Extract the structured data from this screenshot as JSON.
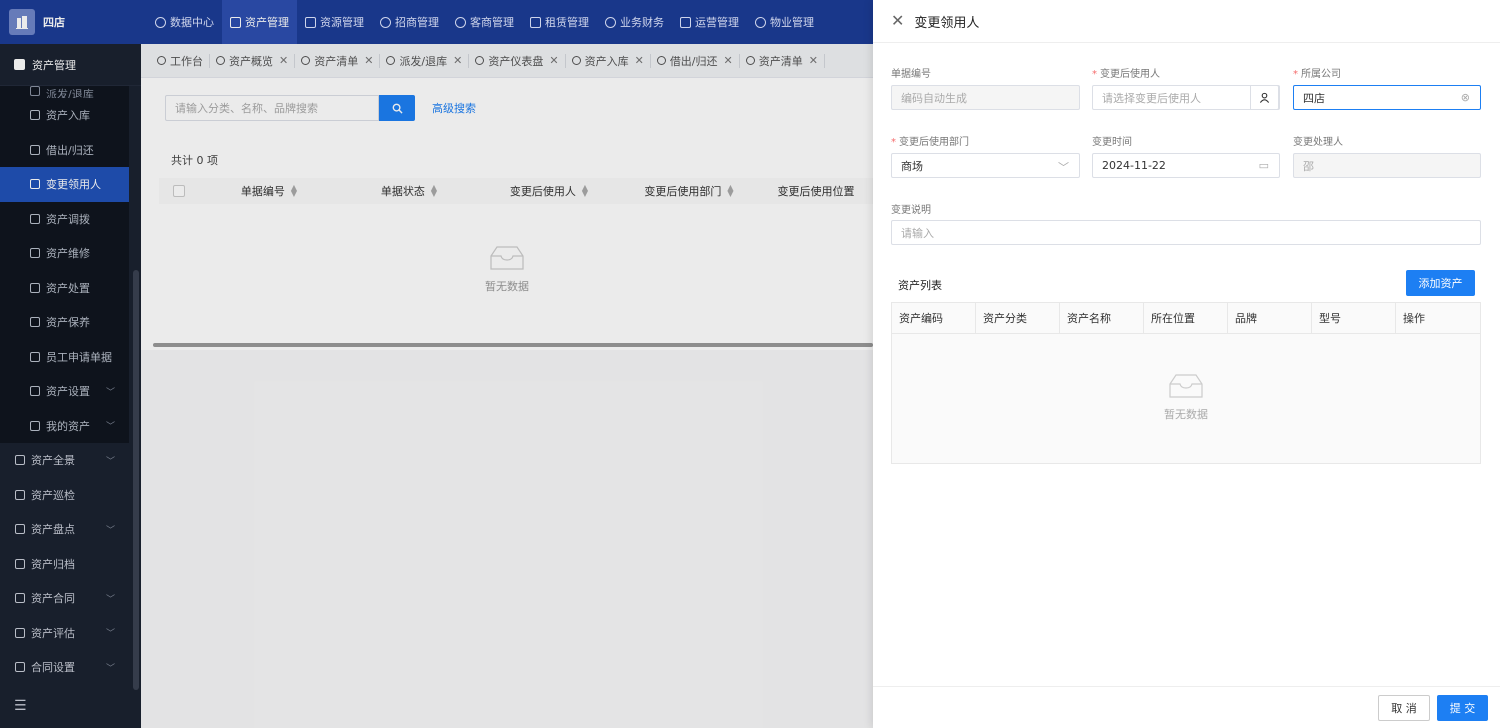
{
  "header": {
    "brand": "四店",
    "nav": [
      "数据中心",
      "资产管理",
      "资源管理",
      "招商管理",
      "客商管理",
      "租赁管理",
      "业务财务",
      "运营管理",
      "物业管理"
    ],
    "active_nav": 1
  },
  "sidebar": {
    "section": "资产管理",
    "sub_items": [
      "派发/退库",
      "资产入库",
      "借出/归还",
      "变更领用人",
      "资产调拨",
      "资产维修",
      "资产处置",
      "资产保养",
      "员工申请单据",
      "资产设置",
      "我的资产"
    ],
    "active_sub": 3,
    "top_items": [
      "资产全景",
      "资产巡检",
      "资产盘点",
      "资产归档",
      "资产合同",
      "资产评估",
      "合同设置"
    ]
  },
  "tabs": [
    "工作台",
    "资产概览",
    "资产清单",
    "派发/退库",
    "资产仪表盘",
    "资产入库",
    "借出/归还",
    "资产清单"
  ],
  "toolbar": {
    "search_placeholder": "请输入分类、名称、品牌搜索",
    "advanced_search": "高级搜索"
  },
  "list": {
    "total": "共计 0 项",
    "columns": [
      "单据编号",
      "单据状态",
      "变更后使用人",
      "变更后使用部门",
      "变更后使用位置"
    ],
    "empty": "暂无数据"
  },
  "drawer": {
    "title": "变更领用人",
    "fields": {
      "doc_no": {
        "label": "单据编号",
        "value": "编码自动生成"
      },
      "new_user": {
        "label": "变更后使用人",
        "placeholder": "请选择变更后使用人"
      },
      "company": {
        "label": "所属公司",
        "value": "四店"
      },
      "department": {
        "label": "变更后使用部门",
        "value": "商场"
      },
      "change_time": {
        "label": "变更时间",
        "value": "2024-11-22"
      },
      "handler": {
        "label": "变更处理人",
        "value": "邵"
      },
      "description": {
        "label": "变更说明",
        "placeholder": "请输入"
      }
    },
    "asset_list": {
      "title": "资产列表",
      "add_button": "添加资产",
      "columns": [
        "资产编码",
        "资产分类",
        "资产名称",
        "所在位置",
        "品牌",
        "型号",
        "操作"
      ],
      "empty": "暂无数据"
    },
    "footer": {
      "cancel": "取 消",
      "submit": "提 交"
    }
  },
  "colors": {
    "primary": "#1d7ff3",
    "topbar": "#1c3c96",
    "sidebar": "#1b2230",
    "required": "#f56c6c"
  }
}
